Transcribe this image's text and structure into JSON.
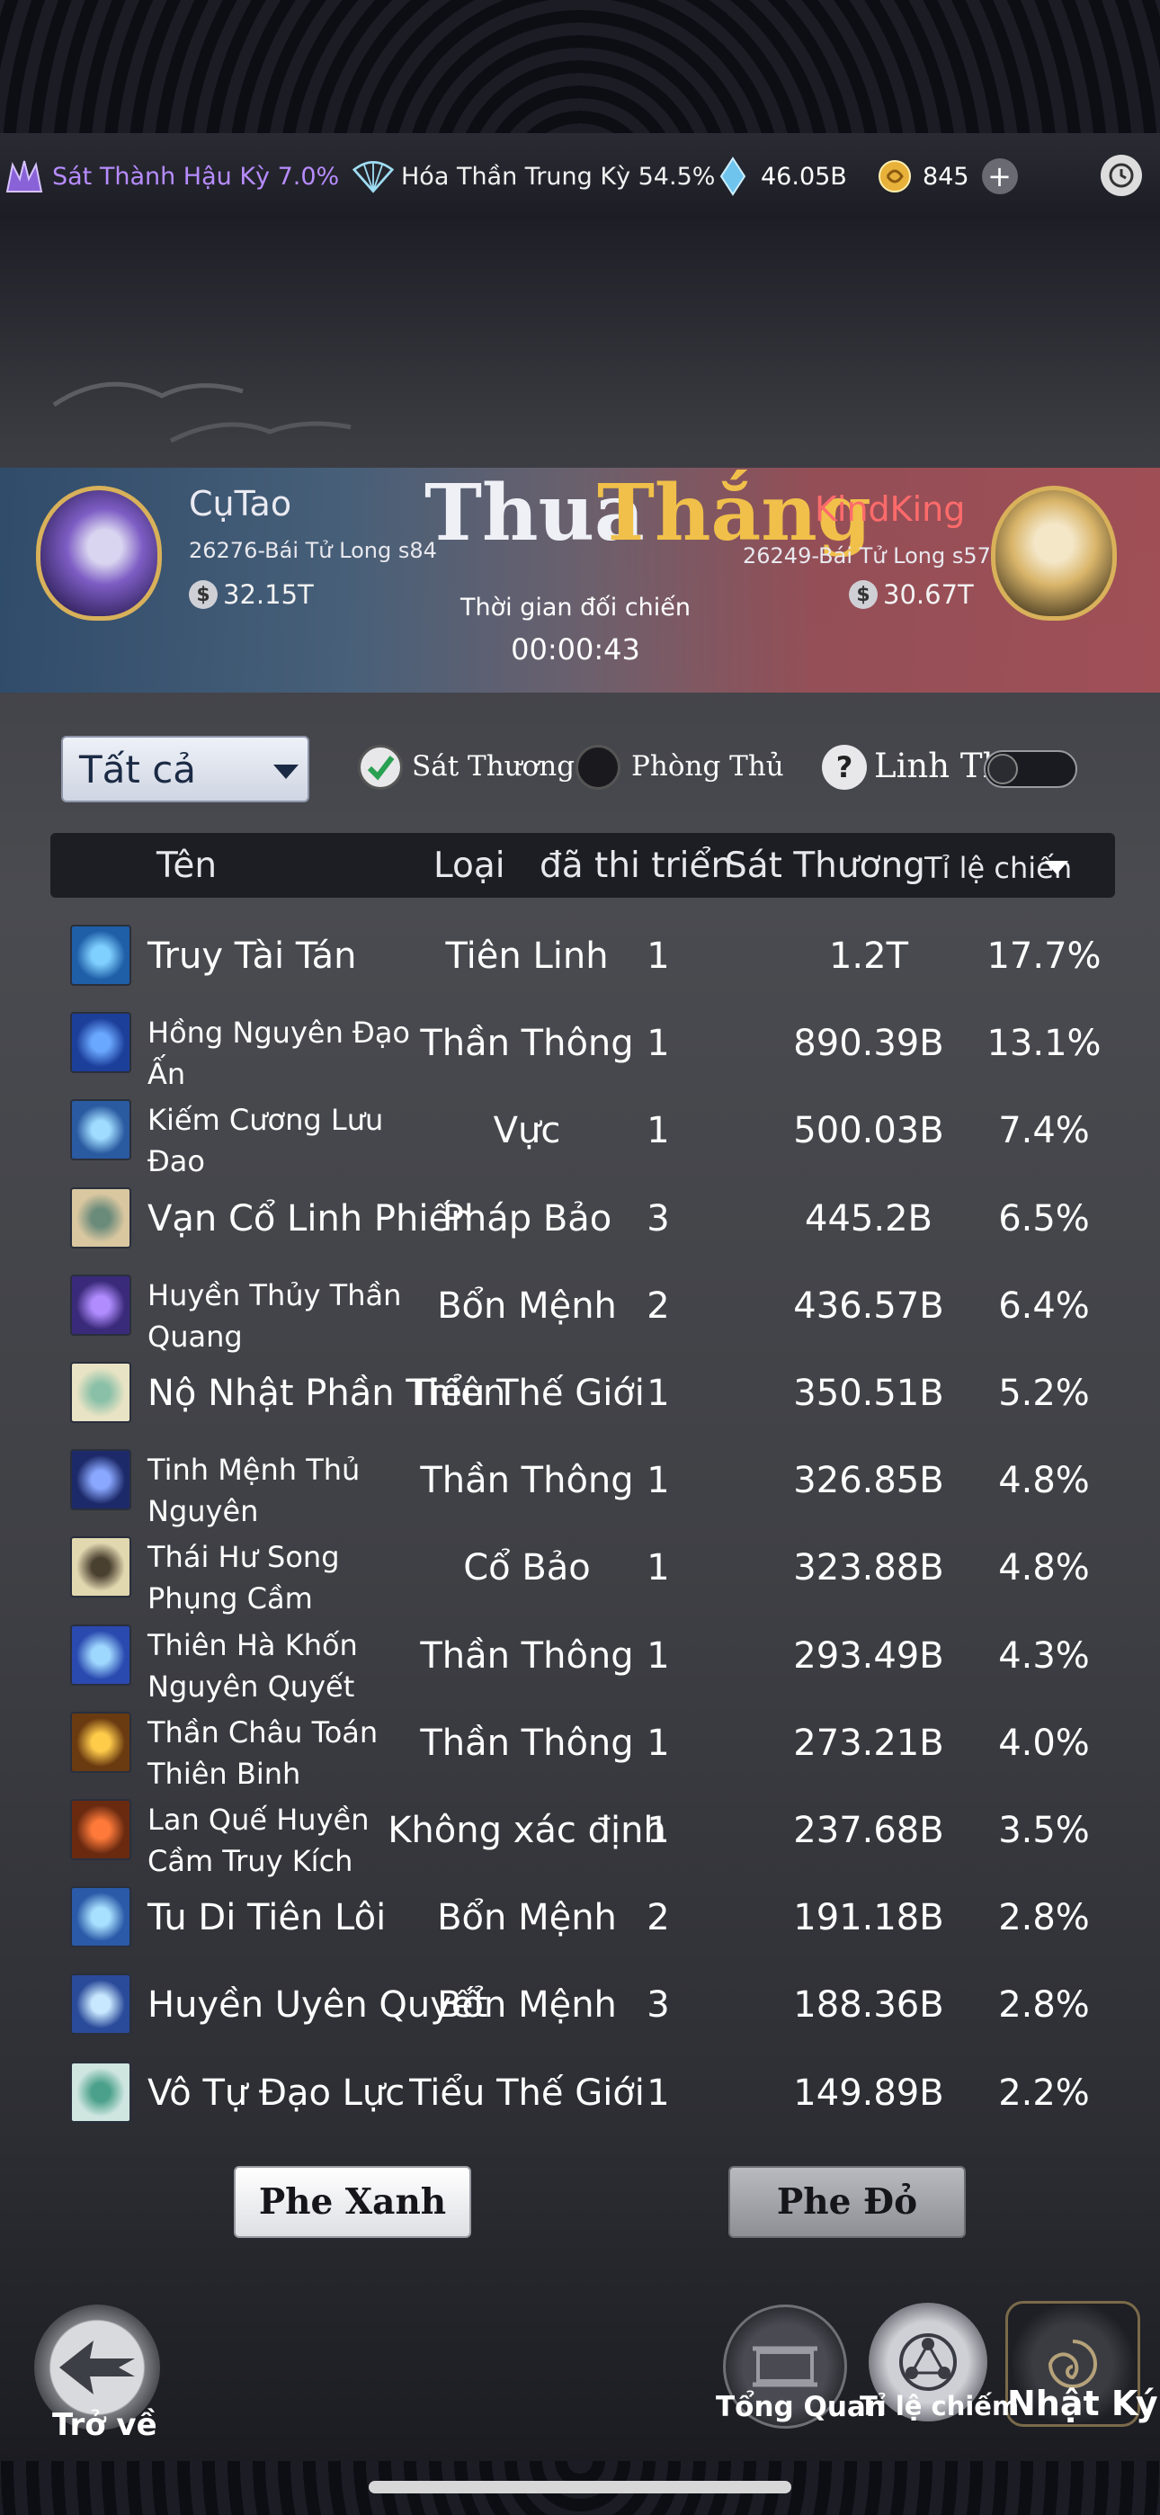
{
  "topbar": {
    "realm1": "Sát Thành Hậu Kỳ 7.0%",
    "realm2": "Hóa Thần Trung Kỳ 54.5%",
    "crystal": "46.05B",
    "coins": "845",
    "plus": "+"
  },
  "left_player": {
    "name": "CụTao",
    "server": "26276-Bái Tử Long s84",
    "power": "32.15T"
  },
  "right_player": {
    "name": "KindKing",
    "server": "26249-Bái Tử Long s57",
    "power": "30.67T"
  },
  "result": {
    "left": "Thua",
    "right": "Thắng"
  },
  "battle": {
    "time_label": "Thời gian đối chiến",
    "time_value": "00:00:43"
  },
  "filters": {
    "dropdown": "Tất cả",
    "damage": "Sát Thương",
    "defense": "Phòng Thủ",
    "help": "?",
    "pet": "Linh Thú"
  },
  "table": {
    "headers": {
      "name": "Tên",
      "type": "Loại",
      "casts": "đã thi triển",
      "damage": "Sát Thương",
      "ratio": "Tỉ lệ chiến"
    },
    "rows": [
      {
        "name": "Truy Tài Tán",
        "type": "Tiên Linh",
        "casts": "1",
        "damage": "1.2T",
        "ratio": "17.7%"
      },
      {
        "name": "Hồng Nguyên Đạo Ấn",
        "type": "Thần Thông",
        "casts": "1",
        "damage": "890.39B",
        "ratio": "13.1%"
      },
      {
        "name": "Kiếm Cương Lưu Đao",
        "type": "Vực",
        "casts": "1",
        "damage": "500.03B",
        "ratio": "7.4%"
      },
      {
        "name": "Vạn Cổ Linh Phiến",
        "type": "Pháp Bảo",
        "casts": "3",
        "damage": "445.2B",
        "ratio": "6.5%"
      },
      {
        "name": "Huyền Thủy Thần Quang",
        "type": "Bổn Mệnh",
        "casts": "2",
        "damage": "436.57B",
        "ratio": "6.4%"
      },
      {
        "name": "Nộ Nhật Phần Thiên",
        "type": "Tiểu Thế Giới",
        "casts": "1",
        "damage": "350.51B",
        "ratio": "5.2%"
      },
      {
        "name": "Tinh Mệnh Thủ Nguyên",
        "type": "Thần Thông",
        "casts": "1",
        "damage": "326.85B",
        "ratio": "4.8%"
      },
      {
        "name": "Thái Hư Song Phụng Cầm",
        "type": "Cổ Bảo",
        "casts": "1",
        "damage": "323.88B",
        "ratio": "4.8%"
      },
      {
        "name": "Thiên Hà Khốn Nguyên Quyết",
        "type": "Thần Thông",
        "casts": "1",
        "damage": "293.49B",
        "ratio": "4.3%"
      },
      {
        "name": "Thần Châu Toán Thiên Binh",
        "type": "Thần Thông",
        "casts": "1",
        "damage": "273.21B",
        "ratio": "4.0%"
      },
      {
        "name": "Lan Quế Huyền Cầm Truy Kích",
        "type": "Không xác định",
        "casts": "1",
        "damage": "237.68B",
        "ratio": "3.5%"
      },
      {
        "name": "Tu Di Tiên Lôi",
        "type": "Bổn Mệnh",
        "casts": "2",
        "damage": "191.18B",
        "ratio": "2.8%"
      },
      {
        "name": "Huyền Uyên Quyết",
        "type": "Bổn Mệnh",
        "casts": "3",
        "damage": "188.36B",
        "ratio": "2.8%"
      },
      {
        "name": "Vô Tự Đạo Lực",
        "type": "Tiểu Thế Giới",
        "casts": "1",
        "damage": "149.89B",
        "ratio": "2.2%"
      }
    ]
  },
  "sides": {
    "blue": "Phe Xanh",
    "red": "Phe Đỏ"
  },
  "nav": {
    "back": "Trở về",
    "overview": "Tổng Quan",
    "ratio": "Tỉ lệ chiếm",
    "log": "Nhật Ký"
  },
  "colors": {
    "realm1": "#b78cff",
    "gold": "#f0c04a",
    "panel_header": "#1d1e23"
  }
}
